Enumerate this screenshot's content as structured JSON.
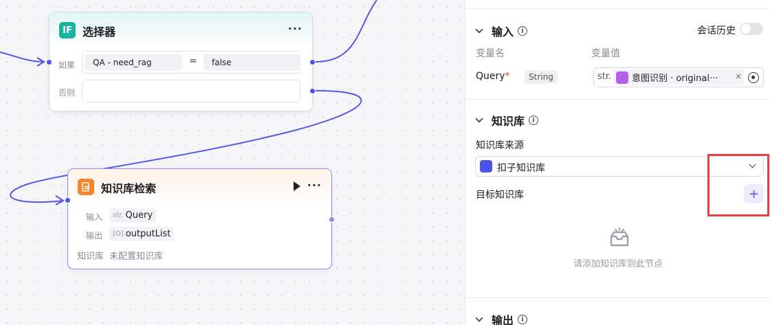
{
  "canvas": {
    "selector_node": {
      "title": "选择器",
      "icon_text": "IF",
      "more": "···",
      "if_label": "如果",
      "else_label": "否则",
      "condition": {
        "left": "QA  -  need_rag",
        "operator": "=",
        "right": "false"
      }
    },
    "kb_node": {
      "title": "知识库检索",
      "more": "···",
      "input_label": "输入",
      "input_type": "str.",
      "input_value": "Query",
      "output_label": "输出",
      "output_type": "[O]",
      "output_value": "outputList",
      "kb_label": "知识库",
      "kb_value": "未配置知识库"
    }
  },
  "panel": {
    "input_section": {
      "title": "输入",
      "history_label": "会话历史",
      "col_name": "变量名",
      "col_value": "变量值",
      "var_name": "Query",
      "required_mark": "*",
      "var_type": "String",
      "value_prefix": "str.",
      "value_chip": "意图识别 · original···",
      "chip_close": "×"
    },
    "kb_section": {
      "title": "知识库",
      "source_label": "知识库来源",
      "source_value": "扣子知识库",
      "target_label": "目标知识库",
      "add_label": "+",
      "empty_text": "请添加知识库到此节点"
    },
    "output_section": {
      "title": "输出"
    },
    "info_glyph": "i"
  },
  "colors": {
    "accent": "#4d53e8",
    "highlight": "#e8403f",
    "if_icon": "#1bb3a0",
    "kb_icon": "#f3862e"
  }
}
